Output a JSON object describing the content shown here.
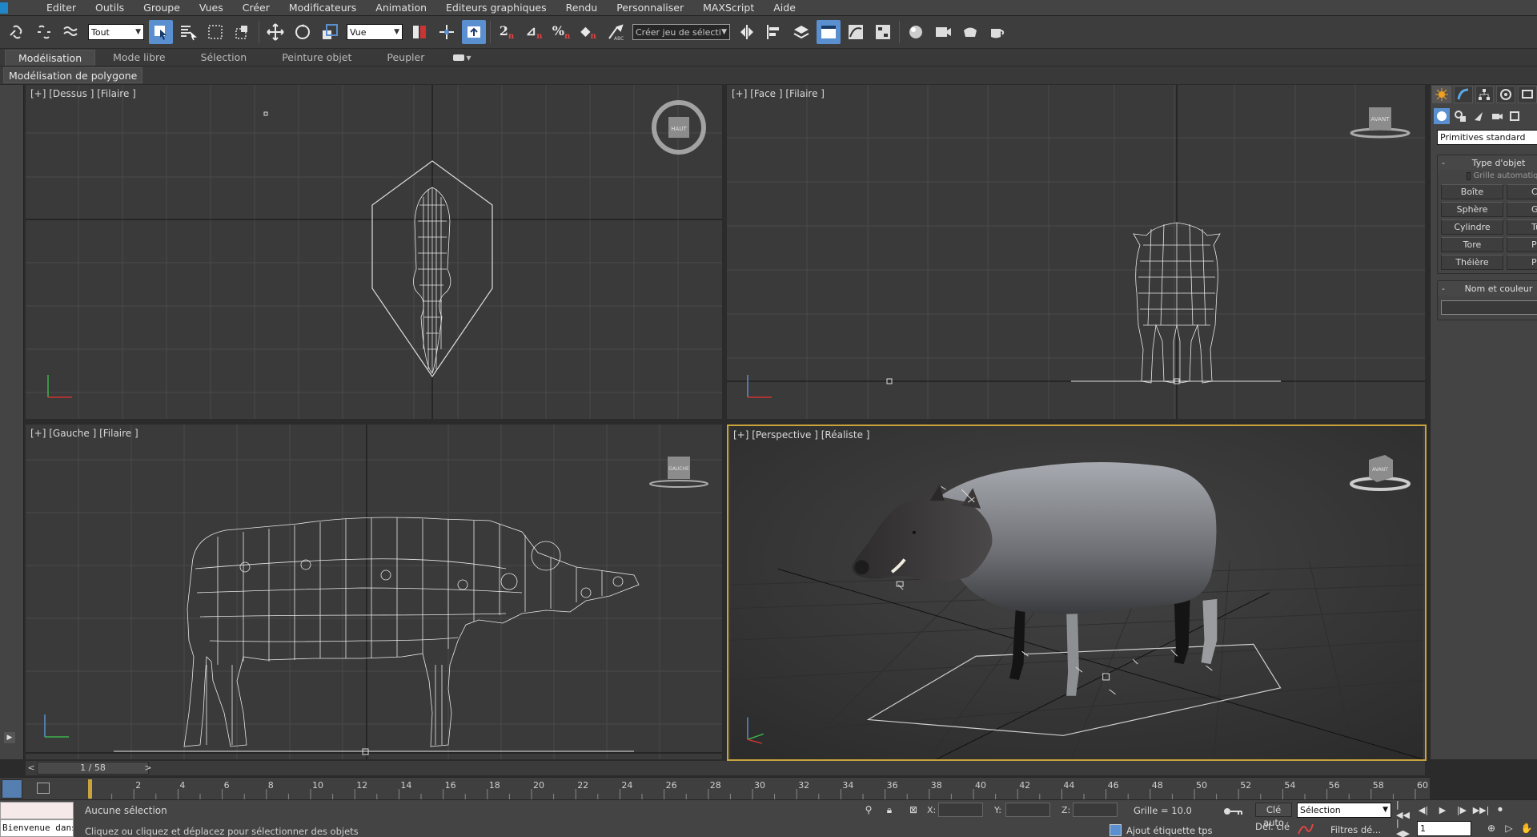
{
  "menu": {
    "items": [
      "Editer",
      "Outils",
      "Groupe",
      "Vues",
      "Créer",
      "Modificateurs",
      "Animation",
      "Editeurs graphiques",
      "Rendu",
      "Personnaliser",
      "MAXScript",
      "Aide"
    ]
  },
  "toolbar": {
    "selection_filter": "Tout",
    "ref_coord_system": "Vue",
    "named_selection_set": "Créer jeu de sélecti",
    "icons": [
      "link-icon",
      "unlink-icon",
      "bind-spacewarp-icon",
      "select-object-icon",
      "select-by-name-icon",
      "rectangular-region-icon",
      "window-crossing-icon",
      "move-icon",
      "rotate-icon",
      "scale-icon",
      "pivot-icon",
      "select-manipulate-icon",
      "keyboard-shortcut-icon",
      "snaps-icon",
      "angle-snap-icon",
      "percent-snap-icon",
      "spinner-snap-icon",
      "edit-named-sets-icon",
      "mirror-icon",
      "align-icon",
      "layer-manager-icon",
      "scene-explorer-icon",
      "curve-editor-icon",
      "schematic-view-icon",
      "material-editor-icon",
      "render-setup-icon",
      "rendered-frame-icon",
      "render-icon"
    ]
  },
  "ribbon": {
    "tabs": [
      "Modélisation",
      "Mode libre",
      "Sélection",
      "Peinture objet",
      "Peupler"
    ],
    "active_tab": "Modélisation",
    "sub_label": "Modélisation de polygone"
  },
  "viewports": {
    "top": {
      "label": "[+] [Dessus ] [Filaire ]",
      "viewcube": "HAUT"
    },
    "front": {
      "label": "[+] [Face ] [Filaire ]",
      "viewcube": "AVANT"
    },
    "left": {
      "label": "[+] [Gauche ] [Filaire ]",
      "viewcube": "GAUCHE"
    },
    "perspective": {
      "label": "[+] [Perspective ] [Réaliste ]",
      "viewcube": "AVANT"
    }
  },
  "command_panel": {
    "category_dropdown": "Primitives standard",
    "object_type": {
      "title": "Type d'objet",
      "autogrid_label": "Grille automatique",
      "buttons": [
        "Boîte",
        "Cône",
        "Sphère",
        "Géosphère",
        "Cylindre",
        "Tube",
        "Tore",
        "Pyramide",
        "Théière",
        "Plan"
      ]
    },
    "name_color": {
      "title": "Nom et couleur"
    }
  },
  "timeline": {
    "slider_label": "1 / 58",
    "prev": "<",
    "next": ">",
    "ticks": [
      2,
      4,
      6,
      8,
      10,
      12,
      14,
      16,
      18,
      20,
      22,
      24,
      26,
      28,
      30,
      32,
      34,
      36,
      38,
      40,
      42,
      44,
      46,
      48,
      50,
      52,
      54,
      56,
      58,
      60
    ]
  },
  "status": {
    "maxscript_text": "Bienvenue dans MAXScript.",
    "selection_text": "Aucune sélection",
    "prompt_text": "Cliquez ou cliquez et déplacez pour sélectionner des objets",
    "x_label": "X:",
    "y_label": "Y:",
    "z_label": "Z:",
    "grid_text": "Grille = 10.0",
    "add_time_tag": "Ajout étiquette tps",
    "auto_key": "Clé auto",
    "set_key": "Déf. clé",
    "key_filter_select": "Sélection",
    "key_filters": "Filtres dé...",
    "current_frame": "1"
  },
  "colors": {
    "accent_blue": "#5a8fd0",
    "active_viewport_border": "#c9a33c",
    "viewport_bg": "#3a3a3a"
  }
}
